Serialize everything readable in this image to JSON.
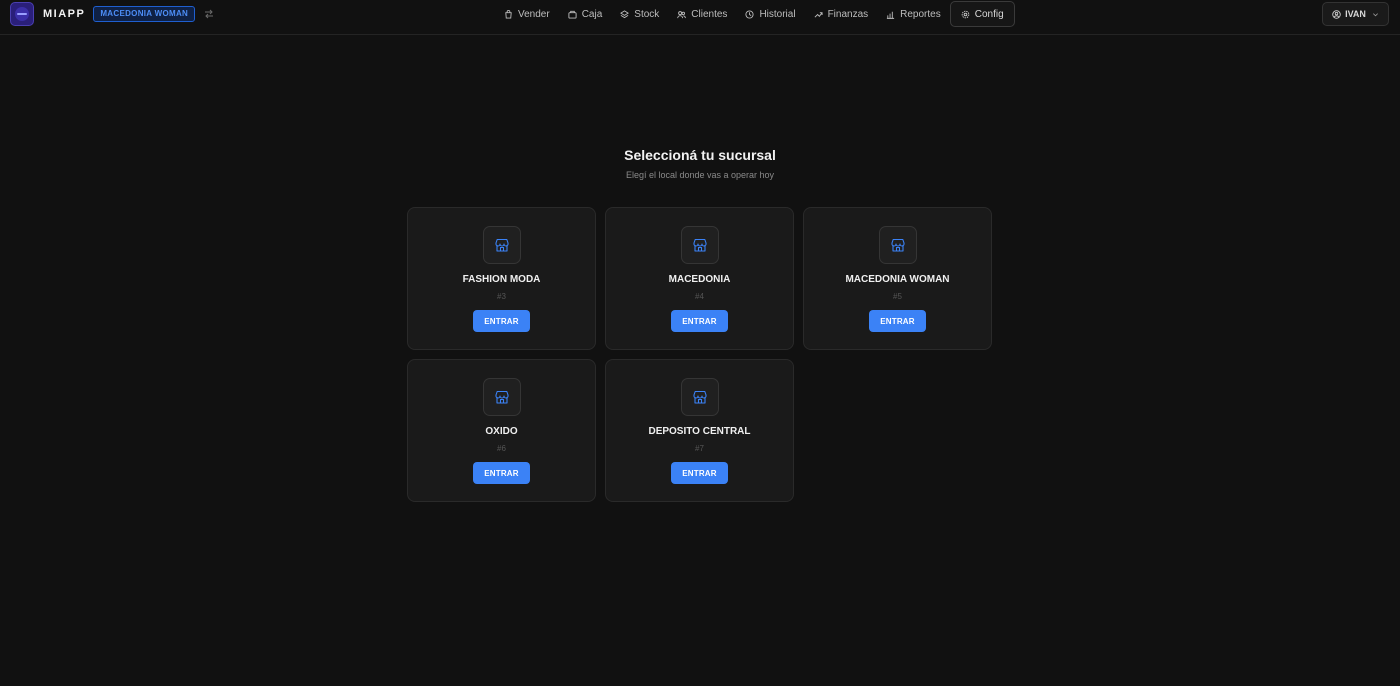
{
  "header": {
    "brand_name": "MIAPP",
    "current_branch": "MACEDONIA WOMAN",
    "nav": [
      {
        "label": "Vender",
        "icon": "shopping-bag-icon"
      },
      {
        "label": "Caja",
        "icon": "register-icon"
      },
      {
        "label": "Stock",
        "icon": "layers-icon"
      },
      {
        "label": "Clientes",
        "icon": "users-icon"
      },
      {
        "label": "Historial",
        "icon": "clock-icon"
      },
      {
        "label": "Finanzas",
        "icon": "trend-icon"
      },
      {
        "label": "Reportes",
        "icon": "bar-chart-icon"
      },
      {
        "label": "Config",
        "icon": "gear-icon",
        "active": true
      }
    ],
    "user_name": "IVAN"
  },
  "main": {
    "title": "Seleccioná tu sucursal",
    "subtitle": "Elegí el local donde vas a operar hoy",
    "branches": [
      {
        "name": "FASHION MODA",
        "number": "#3",
        "button": "ENTRAR"
      },
      {
        "name": "MACEDONIA",
        "number": "#4",
        "button": "ENTRAR"
      },
      {
        "name": "MACEDONIA WOMAN",
        "number": "#5",
        "button": "ENTRAR"
      },
      {
        "name": "OXIDO",
        "number": "#6",
        "button": "ENTRAR"
      },
      {
        "name": "DEPOSITO CENTRAL",
        "number": "#7",
        "button": "ENTRAR"
      }
    ]
  },
  "colors": {
    "background": "#111111",
    "card": "#1a1a1a",
    "accent": "#3b82f6",
    "badge_text": "#4d8ef7"
  }
}
